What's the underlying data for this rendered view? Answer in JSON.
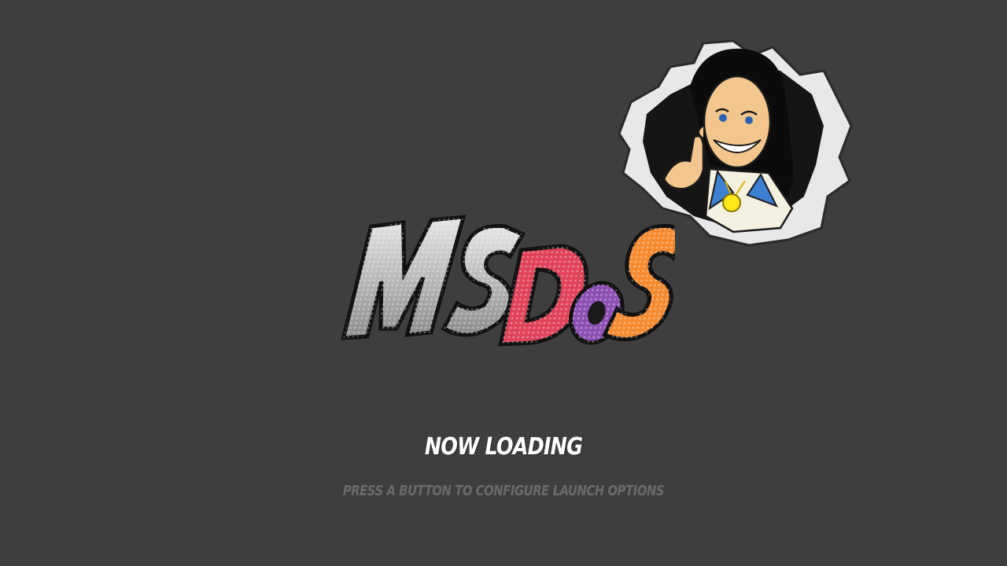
{
  "logo": {
    "text_left": "MS",
    "text_right": "DOS",
    "colors": {
      "ms_fill": "#bdbdbd",
      "d_fill": "#e0425a",
      "o_fill": "#8e4fb4",
      "s_fill": "#f58a30",
      "outline": "#1a1a1a"
    }
  },
  "mascot": {
    "icon": "cartoon-character-mascot"
  },
  "loading": {
    "status_text": "NOW LOADING",
    "hint_text": "PRESS A BUTTON TO CONFIGURE LAUNCH OPTIONS"
  },
  "theme": {
    "background": "#3e3e3e",
    "status_color": "#ffffff",
    "hint_color": "#6a6a6a"
  }
}
